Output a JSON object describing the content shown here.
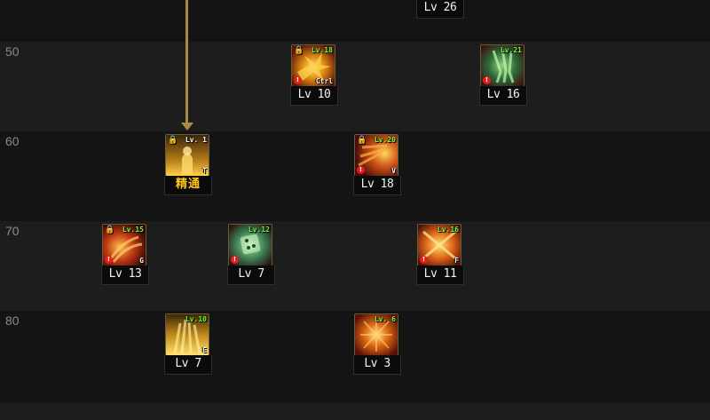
{
  "rows": [
    {
      "label": "50"
    },
    {
      "label": "60"
    },
    {
      "label": "70"
    },
    {
      "label": "80"
    }
  ],
  "colors": {
    "level_tag": "#6cff3a",
    "connector": "#a88a48",
    "warn_badge": "#e51d1d",
    "caption_gold": "#ffc41a"
  },
  "skills": [
    {
      "name": "skill-top-partial",
      "caption": "Lv 26",
      "icon": "partial-skill-icon"
    },
    {
      "name": "skill-50-a",
      "tag": "Lv.18",
      "hotkey": "Ctrl",
      "caption": "Lv 10",
      "locked": true,
      "icon": "golden-explosion-icon"
    },
    {
      "name": "skill-50-b",
      "tag": "Lv.21",
      "caption": "Lv 16",
      "icon": "green-claw-icon"
    },
    {
      "name": "skill-60-a",
      "tag": "Lv. 1",
      "hotkey": "T",
      "caption": "精通",
      "locked": true,
      "icon": "golden-figure-icon"
    },
    {
      "name": "skill-60-b",
      "tag": "Lv.20",
      "hotkey": "V",
      "caption": "Lv 18",
      "locked": true,
      "icon": "fire-burst-icon"
    },
    {
      "name": "skill-70-a",
      "tag": "Lv.15",
      "hotkey": "G",
      "caption": "Lv 13",
      "locked": true,
      "icon": "fire-claw-icon"
    },
    {
      "name": "skill-70-b",
      "tag": "Lv.12",
      "caption": "Lv 7",
      "icon": "green-dice-icon"
    },
    {
      "name": "skill-70-c",
      "tag": "Lv.16",
      "hotkey": "F",
      "caption": "Lv 11",
      "icon": "orange-cross-slash-icon"
    },
    {
      "name": "skill-80-a",
      "tag": "Lv.10",
      "hotkey": "E",
      "caption": "Lv 7",
      "icon": "golden-pillar-icon"
    },
    {
      "name": "skill-80-b",
      "tag": "Lv. 6",
      "caption": "Lv 3",
      "icon": "radiant-flame-icon"
    }
  ]
}
